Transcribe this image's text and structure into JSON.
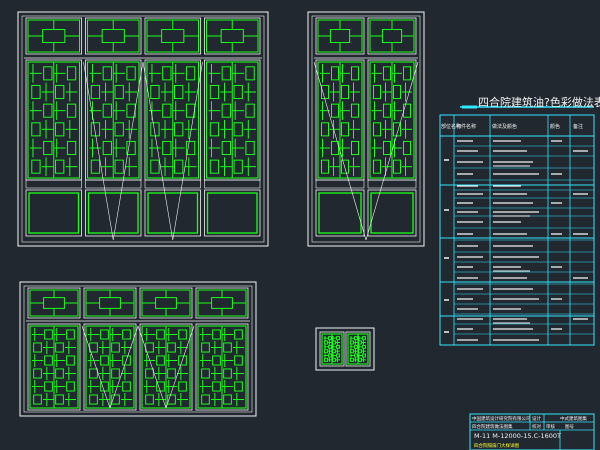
{
  "colors": {
    "background": "#212830",
    "outline": "#f2f2f2",
    "lattice": "#19ff19",
    "table_line": "#33e6ff",
    "table_text": "#f2f2f2",
    "accent_text": "#ffff33",
    "title_line": "#33e6ff"
  },
  "table": {
    "title": "四合院建筑油?色彩做法表",
    "headers": {
      "category": "部位名称",
      "item": "构件名称",
      "method": "做法及颜色",
      "color": "颜色",
      "note": "备注"
    }
  },
  "titleblock": {
    "company": "中国建筑设计研究院有限公司",
    "project": "四合院建筑做法图集",
    "code": "M-11 M-12000-15.C-1600T",
    "drawing_name": "四合院隔扇门大样详图",
    "labels": [
      "设计",
      "校对",
      "审核",
      "图号"
    ],
    "right_label": "中式建筑图集"
  }
}
